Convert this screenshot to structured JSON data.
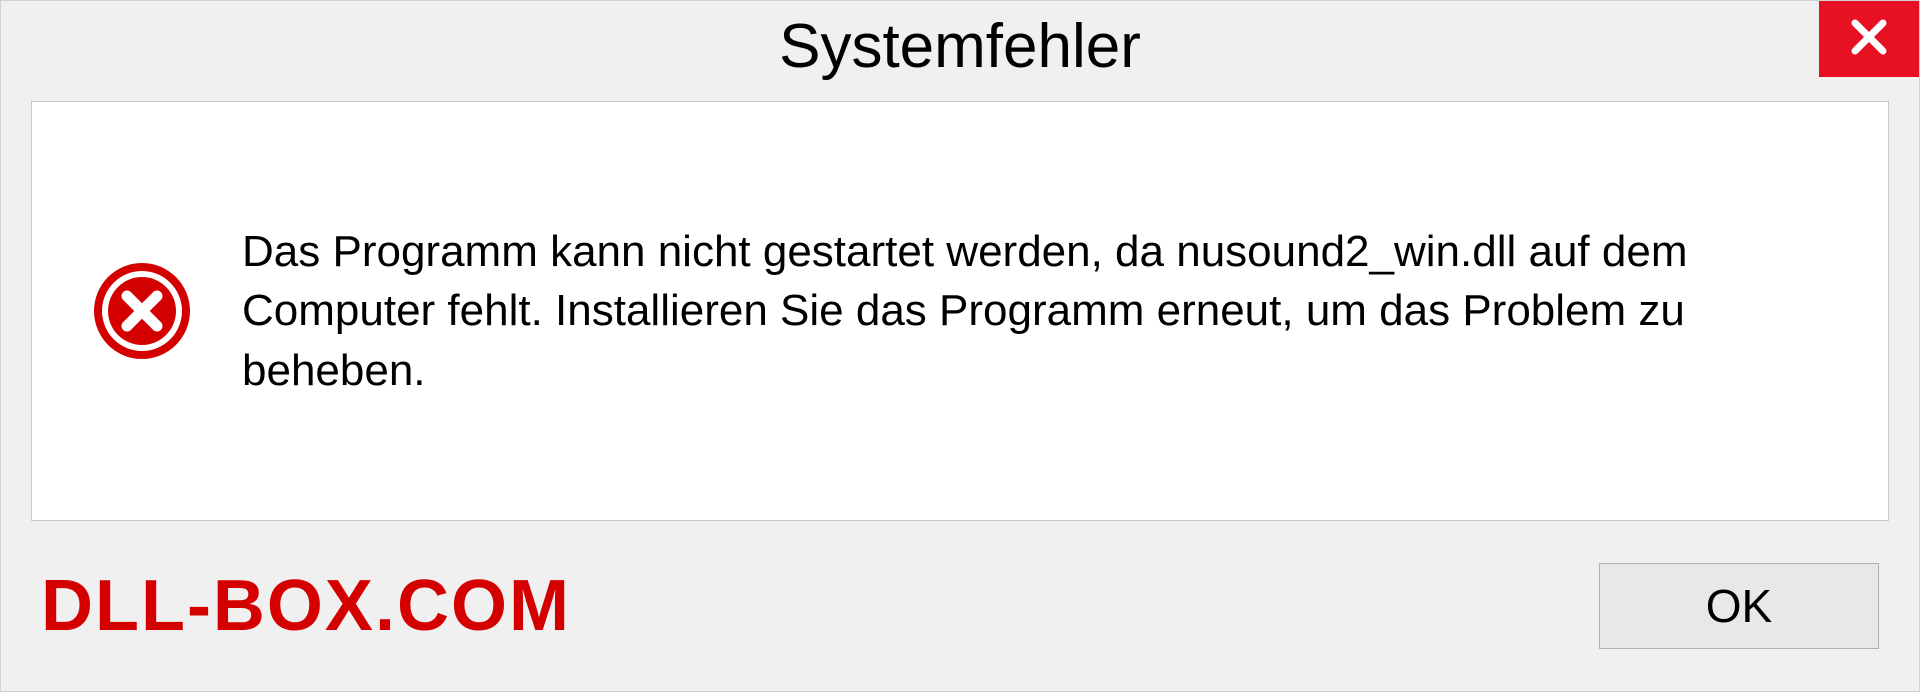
{
  "dialog": {
    "title": "Systemfehler",
    "message": "Das Programm kann nicht gestartet werden, da nusound2_win.dll auf dem Computer fehlt. Installieren Sie das Programm erneut, um das Problem zu beheben.",
    "ok_label": "OK"
  },
  "watermark": "DLL-BOX.COM",
  "colors": {
    "close_bg": "#e81123",
    "error_icon": "#d40000",
    "watermark": "#d40000"
  }
}
